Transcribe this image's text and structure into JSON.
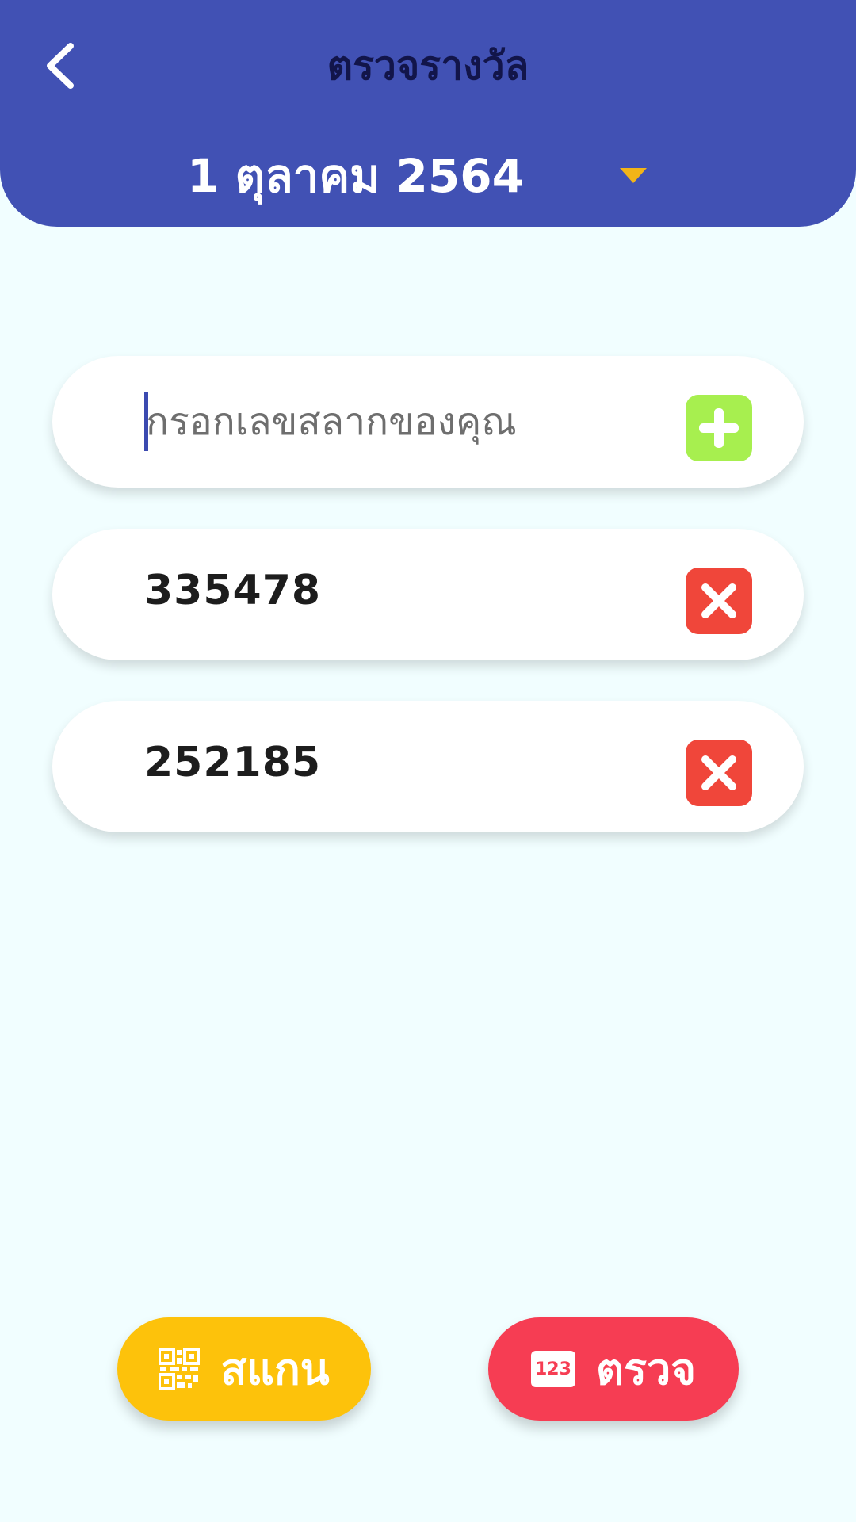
{
  "header": {
    "title": "ตรวจรางวัล",
    "date": "1 ตุลาคม 2564",
    "back_icon": "chevron-left-icon",
    "dropdown_icon": "caret-down-icon",
    "background_color": "#4151b4",
    "accent_color": "#f2b418"
  },
  "input": {
    "placeholder": "กรอกเลขสลากของคุณ",
    "value": "",
    "add_icon": "plus-icon"
  },
  "entries": [
    {
      "number": "335478",
      "remove_icon": "close-icon"
    },
    {
      "number": "252185",
      "remove_icon": "close-icon"
    }
  ],
  "buttons": {
    "scan_label": "สแกน",
    "scan_icon": "qr-code-icon",
    "check_label": "ตรวจ",
    "check_icon_text": "123"
  }
}
